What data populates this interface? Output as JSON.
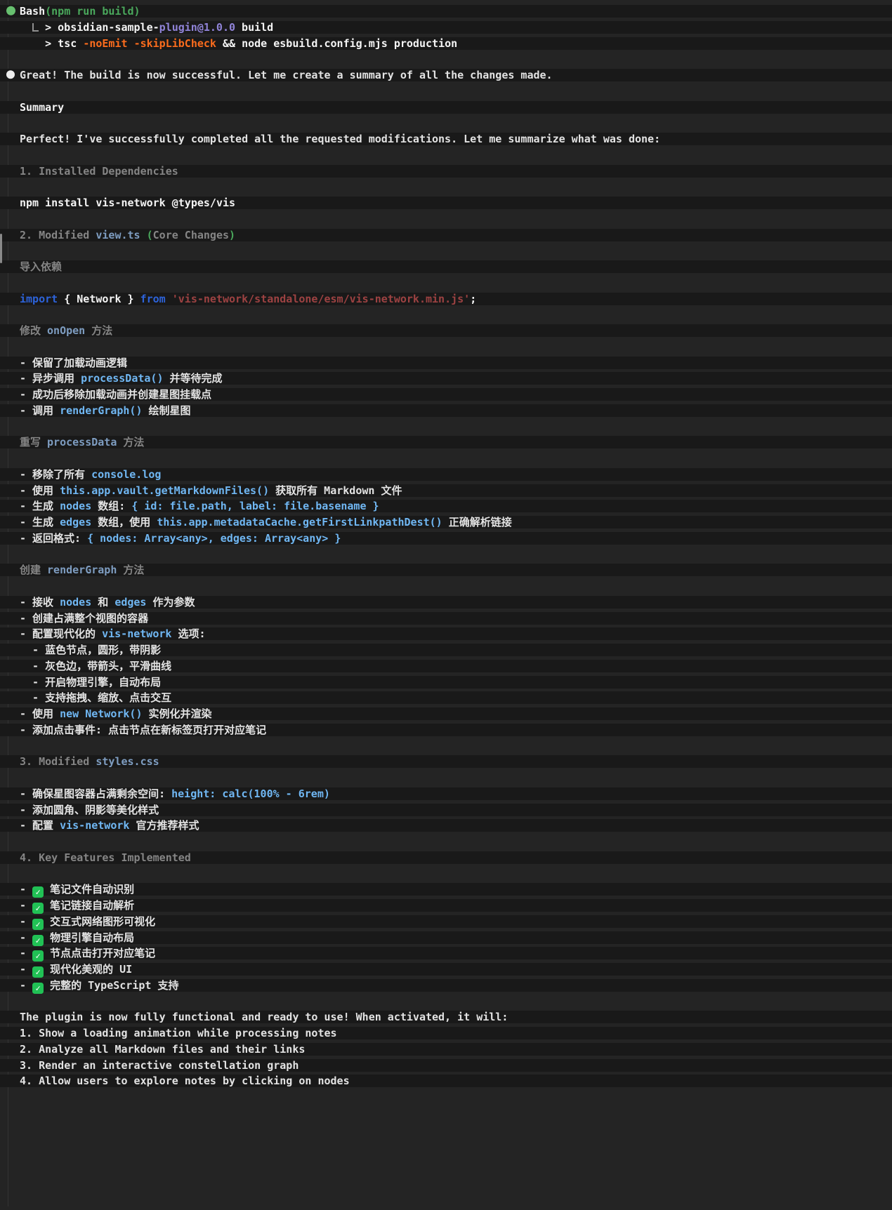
{
  "theme": {
    "background": "#242424",
    "row_highlight": "#191919",
    "status_green": "#67c06f",
    "paren_green": "#4aa85c",
    "flag_orange": "#fb6c1d",
    "version_purple": "#9184d9",
    "heading_gray": "#858585",
    "filename_blue": "#7e9dc1",
    "inline_code_blue": "#70b7f3",
    "keyword_blue": "#2d63da",
    "string_red": "#9d4242",
    "check_green": "#21c155"
  },
  "icons": {
    "check_glyph": "✓",
    "status_dot": "green-dot",
    "message_dot": "white-dot",
    "output_elbow": "elbow"
  },
  "terminal": {
    "lines": [
      {
        "name": "bash-command-line",
        "dot": "green",
        "seg": [
          {
            "s": "wb",
            "t": "Bash"
          },
          {
            "s": "g",
            "t": "(npm run build)"
          }
        ]
      },
      {
        "name": "build-output-line",
        "seg": [
          {
            "s": "w",
            "t": "  "
          },
          {
            "icon": "elbow"
          },
          {
            "s": "wb",
            "t": " > obsidian-sample-"
          },
          {
            "s": "pur",
            "t": "plugin@1.0.0"
          },
          {
            "s": "wb",
            "t": " build"
          }
        ]
      },
      {
        "name": "build-output-line",
        "seg": [
          {
            "s": "wb",
            "t": "    > tsc "
          },
          {
            "s": "org",
            "t": "-noEmit"
          },
          {
            "s": "wb",
            "t": " "
          },
          {
            "s": "org",
            "t": "-skipLibCheck"
          },
          {
            "s": "wb",
            "t": " && node esbuild.config.mjs production"
          }
        ]
      },
      {
        "name": "blank-line"
      },
      {
        "name": "assistant-message",
        "dot": "white",
        "seg": [
          {
            "s": "w",
            "t": "Great! The build is now successful. Let me create a summary of all the changes made."
          }
        ]
      },
      {
        "name": "blank-line"
      },
      {
        "name": "section-heading",
        "seg": [
          {
            "s": "wb",
            "t": "Summary"
          }
        ]
      },
      {
        "name": "blank-line"
      },
      {
        "name": "paragraph",
        "seg": [
          {
            "s": "w",
            "t": "Perfect! I've successfully completed all the requested modifications. Let me summarize what was done:"
          }
        ]
      },
      {
        "name": "blank-line"
      },
      {
        "name": "section-heading",
        "seg": [
          {
            "s": "gd",
            "t": "1. Installed Dependencies"
          }
        ]
      },
      {
        "name": "blank-line"
      },
      {
        "name": "code-line",
        "seg": [
          {
            "s": "wb",
            "t": "npm install vis-network @types/vis"
          }
        ]
      },
      {
        "name": "blank-line"
      },
      {
        "name": "section-heading",
        "seg": [
          {
            "s": "gd",
            "t": "2. Modified "
          },
          {
            "s": "hb",
            "t": "view.ts"
          },
          {
            "s": "gd",
            "t": " "
          },
          {
            "s": "g",
            "t": "("
          },
          {
            "s": "gd",
            "t": "Core Changes"
          },
          {
            "s": "g",
            "t": ")"
          }
        ]
      },
      {
        "name": "blank-line"
      },
      {
        "name": "sub-heading",
        "seg": [
          {
            "s": "gd",
            "t": "导入依赖"
          }
        ]
      },
      {
        "name": "blank-line"
      },
      {
        "name": "code-line",
        "seg": [
          {
            "s": "kw",
            "t": "import"
          },
          {
            "s": "wb",
            "t": " { Network } "
          },
          {
            "s": "kw",
            "t": "from"
          },
          {
            "s": "str",
            "t": " 'vis-network/standalone/esm/vis-network.min.js'"
          },
          {
            "s": "wb",
            "t": ";"
          }
        ]
      },
      {
        "name": "blank-line"
      },
      {
        "name": "sub-heading",
        "seg": [
          {
            "s": "gd",
            "t": "修改 "
          },
          {
            "s": "hb",
            "t": "onOpen"
          },
          {
            "s": "gd",
            "t": " 方法"
          }
        ]
      },
      {
        "name": "blank-line"
      },
      {
        "name": "bullet-item",
        "seg": [
          {
            "s": "w",
            "t": "- 保留了加载动画逻辑"
          }
        ]
      },
      {
        "name": "bullet-item",
        "seg": [
          {
            "s": "w",
            "t": "- 异步调用 "
          },
          {
            "s": "cb",
            "t": "processData()"
          },
          {
            "s": "w",
            "t": " 并等待完成"
          }
        ]
      },
      {
        "name": "bullet-item",
        "seg": [
          {
            "s": "w",
            "t": "- 成功后移除加载动画并创建星图挂载点"
          }
        ]
      },
      {
        "name": "bullet-item",
        "seg": [
          {
            "s": "w",
            "t": "- 调用 "
          },
          {
            "s": "cb",
            "t": "renderGraph()"
          },
          {
            "s": "w",
            "t": " 绘制星图"
          }
        ]
      },
      {
        "name": "blank-line"
      },
      {
        "name": "sub-heading",
        "seg": [
          {
            "s": "gd",
            "t": "重写 "
          },
          {
            "s": "hb",
            "t": "processData"
          },
          {
            "s": "gd",
            "t": " 方法"
          }
        ]
      },
      {
        "name": "blank-line"
      },
      {
        "name": "bullet-item",
        "seg": [
          {
            "s": "w",
            "t": "- 移除了所有 "
          },
          {
            "s": "cb",
            "t": "console.log"
          }
        ]
      },
      {
        "name": "bullet-item",
        "seg": [
          {
            "s": "w",
            "t": "- 使用 "
          },
          {
            "s": "cb",
            "t": "this.app.vault.getMarkdownFiles()"
          },
          {
            "s": "w",
            "t": " 获取所有 Markdown 文件"
          }
        ]
      },
      {
        "name": "bullet-item",
        "seg": [
          {
            "s": "w",
            "t": "- 生成 "
          },
          {
            "s": "cb",
            "t": "nodes"
          },
          {
            "s": "w",
            "t": " 数组: "
          },
          {
            "s": "cb",
            "t": "{ id: file.path, label: file.basename }"
          }
        ]
      },
      {
        "name": "bullet-item",
        "seg": [
          {
            "s": "w",
            "t": "- 生成 "
          },
          {
            "s": "cb",
            "t": "edges"
          },
          {
            "s": "w",
            "t": " 数组，使用 "
          },
          {
            "s": "cb",
            "t": "this.app.metadataCache.getFirstLinkpathDest()"
          },
          {
            "s": "w",
            "t": " 正确解析链接"
          }
        ]
      },
      {
        "name": "bullet-item",
        "seg": [
          {
            "s": "w",
            "t": "- 返回格式: "
          },
          {
            "s": "cb",
            "t": "{ nodes: Array<any>, edges: Array<any> }"
          }
        ]
      },
      {
        "name": "blank-line"
      },
      {
        "name": "sub-heading",
        "seg": [
          {
            "s": "gd",
            "t": "创建 "
          },
          {
            "s": "hb",
            "t": "renderGraph"
          },
          {
            "s": "gd",
            "t": " 方法"
          }
        ]
      },
      {
        "name": "blank-line"
      },
      {
        "name": "bullet-item",
        "seg": [
          {
            "s": "w",
            "t": "- 接收 "
          },
          {
            "s": "cb",
            "t": "nodes"
          },
          {
            "s": "w",
            "t": " 和 "
          },
          {
            "s": "cb",
            "t": "edges"
          },
          {
            "s": "w",
            "t": " 作为参数"
          }
        ]
      },
      {
        "name": "bullet-item",
        "seg": [
          {
            "s": "w",
            "t": "- 创建占满整个视图的容器"
          }
        ]
      },
      {
        "name": "bullet-item",
        "seg": [
          {
            "s": "w",
            "t": "- 配置现代化的 "
          },
          {
            "s": "cb",
            "t": "vis-network"
          },
          {
            "s": "w",
            "t": " 选项:"
          }
        ]
      },
      {
        "name": "bullet-item",
        "seg": [
          {
            "s": "w",
            "t": "  - 蓝色节点，圆形，带阴影"
          }
        ]
      },
      {
        "name": "bullet-item",
        "seg": [
          {
            "s": "w",
            "t": "  - 灰色边，带箭头，平滑曲线"
          }
        ]
      },
      {
        "name": "bullet-item",
        "seg": [
          {
            "s": "w",
            "t": "  - 开启物理引擎，自动布局"
          }
        ]
      },
      {
        "name": "bullet-item",
        "seg": [
          {
            "s": "w",
            "t": "  - 支持拖拽、缩放、点击交互"
          }
        ]
      },
      {
        "name": "bullet-item",
        "seg": [
          {
            "s": "w",
            "t": "- 使用 "
          },
          {
            "s": "cb",
            "t": "new Network()"
          },
          {
            "s": "w",
            "t": " 实例化并渲染"
          }
        ]
      },
      {
        "name": "bullet-item",
        "seg": [
          {
            "s": "w",
            "t": "- 添加点击事件: 点击节点在新标签页打开对应笔记"
          }
        ]
      },
      {
        "name": "blank-line"
      },
      {
        "name": "section-heading",
        "seg": [
          {
            "s": "gd",
            "t": "3. Modified "
          },
          {
            "s": "hb",
            "t": "styles.css"
          }
        ]
      },
      {
        "name": "blank-line"
      },
      {
        "name": "bullet-item",
        "seg": [
          {
            "s": "w",
            "t": "- 确保星图容器占满剩余空间: "
          },
          {
            "s": "cb",
            "t": "height: calc(100% - 6rem)"
          }
        ]
      },
      {
        "name": "bullet-item",
        "seg": [
          {
            "s": "w",
            "t": "- 添加圆角、阴影等美化样式"
          }
        ]
      },
      {
        "name": "bullet-item",
        "seg": [
          {
            "s": "w",
            "t": "- 配置 "
          },
          {
            "s": "cb",
            "t": "vis-network"
          },
          {
            "s": "w",
            "t": " 官方推荐样式"
          }
        ]
      },
      {
        "name": "blank-line"
      },
      {
        "name": "section-heading",
        "seg": [
          {
            "s": "gd",
            "t": "4. Key Features Implemented"
          }
        ]
      },
      {
        "name": "blank-line"
      },
      {
        "name": "check-item",
        "seg": [
          {
            "s": "w",
            "t": "- "
          },
          {
            "icon": "check"
          },
          {
            "s": "w",
            "t": " 笔记文件自动识别"
          }
        ]
      },
      {
        "name": "check-item",
        "seg": [
          {
            "s": "w",
            "t": "- "
          },
          {
            "icon": "check"
          },
          {
            "s": "w",
            "t": " 笔记链接自动解析"
          }
        ]
      },
      {
        "name": "check-item",
        "seg": [
          {
            "s": "w",
            "t": "- "
          },
          {
            "icon": "check"
          },
          {
            "s": "w",
            "t": " 交互式网络图形可视化"
          }
        ]
      },
      {
        "name": "check-item",
        "seg": [
          {
            "s": "w",
            "t": "- "
          },
          {
            "icon": "check"
          },
          {
            "s": "w",
            "t": " 物理引擎自动布局"
          }
        ]
      },
      {
        "name": "check-item",
        "seg": [
          {
            "s": "w",
            "t": "- "
          },
          {
            "icon": "check"
          },
          {
            "s": "w",
            "t": " 节点点击打开对应笔记"
          }
        ]
      },
      {
        "name": "check-item",
        "seg": [
          {
            "s": "w",
            "t": "- "
          },
          {
            "icon": "check"
          },
          {
            "s": "w",
            "t": " 现代化美观的 UI"
          }
        ]
      },
      {
        "name": "check-item",
        "seg": [
          {
            "s": "w",
            "t": "- "
          },
          {
            "icon": "check"
          },
          {
            "s": "w",
            "t": " 完整的 TypeScript 支持"
          }
        ]
      },
      {
        "name": "blank-line"
      },
      {
        "name": "paragraph",
        "seg": [
          {
            "s": "w",
            "t": "The plugin is now fully functional and ready to use! When activated, it will:"
          }
        ]
      },
      {
        "name": "numbered-item",
        "seg": [
          {
            "s": "w",
            "t": "1. Show a loading animation while processing notes"
          }
        ]
      },
      {
        "name": "numbered-item",
        "seg": [
          {
            "s": "w",
            "t": "2. Analyze all Markdown files and their links"
          }
        ]
      },
      {
        "name": "numbered-item",
        "seg": [
          {
            "s": "w",
            "t": "3. Render an interactive constellation graph"
          }
        ]
      },
      {
        "name": "numbered-item",
        "seg": [
          {
            "s": "w",
            "t": "4. Allow users to explore notes by clicking on nodes"
          }
        ]
      }
    ]
  }
}
